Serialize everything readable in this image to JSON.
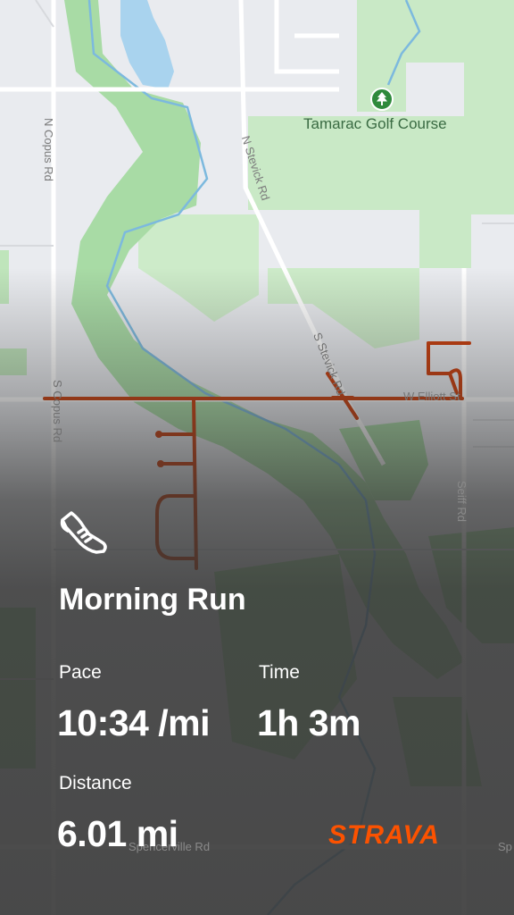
{
  "map": {
    "roads": [
      "N Copus Rd",
      "N Stevick Rd",
      "S Stevick Rd",
      "S Copus Rd",
      "W Elliott St",
      "Seiff Rd",
      "Spencerville Rd",
      "Sp"
    ],
    "poi": "Tamarac Golf Course",
    "route_color": "#c93c0a"
  },
  "activity": {
    "icon": "running-shoe-icon",
    "title": "Morning Run",
    "pace_label": "Pace",
    "pace_value": "10:34 /mi",
    "time_label": "Time",
    "time_value": "1h 3m",
    "distance_label": "Distance",
    "distance_value": "6.01 mi"
  },
  "brand": {
    "name": "STRAVA",
    "color": "#fc5200"
  }
}
